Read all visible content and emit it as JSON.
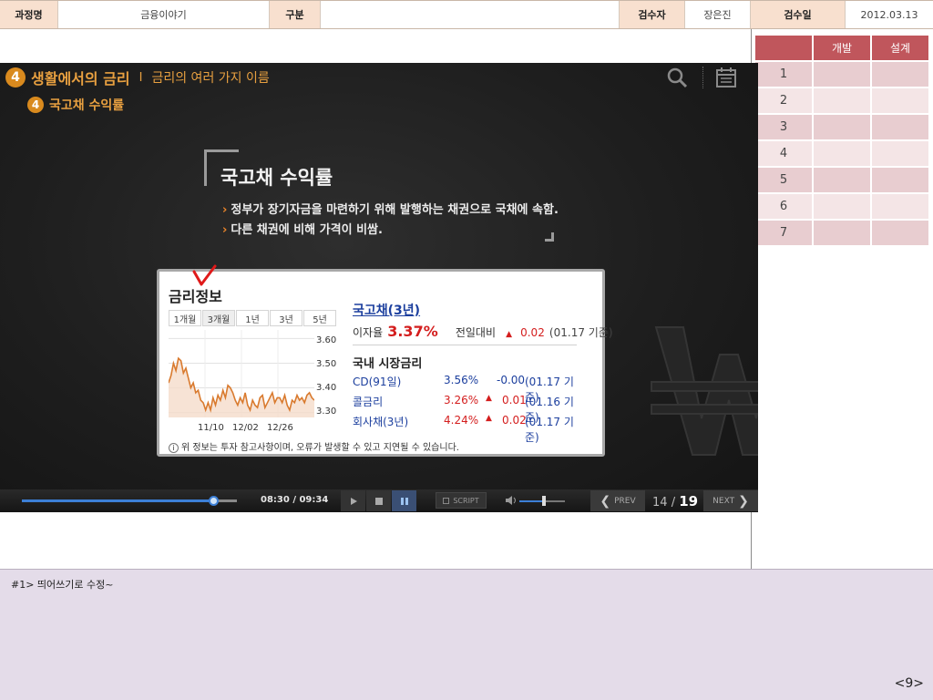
{
  "header": {
    "course_label": "과정명",
    "course_value": "금융이야기",
    "category_label": "구분",
    "category_value": "",
    "reviewer_label": "검수자",
    "reviewer_value": "장은진",
    "date_label": "검수일",
    "date_value": "2012.03.13"
  },
  "review_table": {
    "headers": [
      "",
      "개발",
      "설계"
    ],
    "rows": [
      "1",
      "2",
      "3",
      "4",
      "5",
      "6",
      "7"
    ]
  },
  "slide": {
    "chapter_num": "4",
    "chapter_title": "생활에서의 금리",
    "separator": "I",
    "section_title": "금리의 여러 가지 이름",
    "sub_num": "4",
    "sub_title": "국고채 수익률",
    "heading": "국고채 수익률",
    "bullets": [
      "정부가 장기자금을 마련하기 위해 발행하는 채권으로 국채에 속함.",
      "다른 채권에 비해 가격이 비쌈."
    ],
    "bullet_mark": "›",
    "icons": {
      "search": "search-icon",
      "memo": "memo-icon"
    }
  },
  "rate_widget": {
    "title": "금리정보",
    "tabs": [
      "1개월",
      "3개월",
      "1년",
      "3년",
      "5년"
    ],
    "active_tab": "3개월",
    "bond_link": "국고채(3년)",
    "rate_label": "이자율",
    "rate_value": "3.37%",
    "compare_label": "전일대비",
    "change": "0.02",
    "change_date": "(01.17 기준)",
    "market_title": "국내 시장금리",
    "market": [
      {
        "name": "CD(91일)",
        "rate": "3.56%",
        "change": "-0.00",
        "date": "(01.17 기준)",
        "up": false
      },
      {
        "name": "콜금리",
        "rate": "3.26%",
        "change": "0.01",
        "date": "(01.16 기준)",
        "up": true
      },
      {
        "name": "회사채(3년)",
        "rate": "4.24%",
        "change": "0.02",
        "date": "(01.17 기준)",
        "up": true
      }
    ],
    "notice": "위 정보는 투자 참고사항이며, 오류가 발생할 수 있고 지연될 수 있습니다."
  },
  "chart_data": {
    "type": "line",
    "title": "",
    "xlabel": "",
    "ylabel": "",
    "x_ticks": [
      "11/10",
      "12/02",
      "12/26"
    ],
    "y_ticks": [
      "3.60",
      "3.50",
      "3.40",
      "3.30"
    ],
    "ylim": [
      3.28,
      3.62
    ],
    "series": [
      {
        "values": [
          3.42,
          3.45,
          3.5,
          3.47,
          3.52,
          3.51,
          3.46,
          3.48,
          3.44,
          3.4,
          3.42,
          3.38,
          3.39,
          3.35,
          3.34,
          3.31,
          3.34,
          3.31,
          3.36,
          3.33,
          3.37,
          3.35,
          3.39,
          3.36,
          3.41,
          3.4,
          3.38,
          3.35,
          3.33,
          3.36,
          3.34,
          3.38,
          3.33,
          3.31,
          3.35,
          3.33,
          3.32,
          3.36,
          3.37,
          3.32,
          3.34,
          3.36,
          3.38,
          3.34,
          3.36,
          3.36,
          3.34,
          3.37,
          3.33,
          3.31,
          3.35,
          3.34,
          3.37,
          3.35,
          3.36,
          3.34,
          3.37,
          3.38,
          3.36,
          3.35
        ]
      }
    ],
    "line_color": "#d97a2e",
    "grid": true
  },
  "player": {
    "time": "08:30 / 09:34",
    "progress": 0.887,
    "script_label": "SCRIPT",
    "volume": 0.54,
    "prev_label": "PREV",
    "next_label": "NEXT",
    "page_current": "14",
    "page_sep": "/",
    "page_total": "19"
  },
  "comment": {
    "text": "#1> 띄어쓰기로 수정~",
    "page_number": "<9>"
  },
  "colors": {
    "accent": "#e8a040",
    "table_header": "#c0565c",
    "label_bg": "#f8e0cf"
  }
}
